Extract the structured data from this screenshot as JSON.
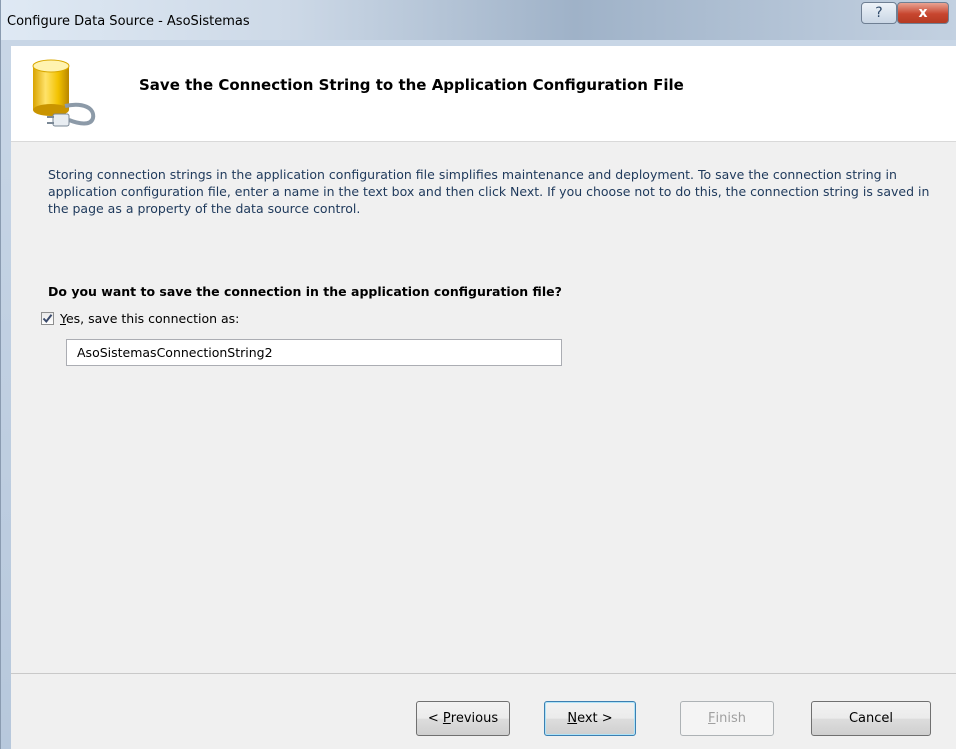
{
  "window": {
    "title": "Configure Data Source - AsoSistemas",
    "help_glyph": "?",
    "close_glyph": "x"
  },
  "header": {
    "title": "Save the Connection String to the Application Configuration File",
    "icon": "database-plug-icon"
  },
  "content": {
    "description": "Storing connection strings in the application configuration file simplifies maintenance and deployment. To save the connection string in application configuration file, enter a name in the text box and then click Next. If you choose not to do this, the connection string is saved in the page as a property of the data source control.",
    "question": "Do you want to save the connection in the application configuration file?",
    "checkbox": {
      "checked": true,
      "accel": "Y",
      "label_rest": "es, save this connection as:"
    },
    "connection_name": "AsoSistemasConnectionString2"
  },
  "buttons": {
    "previous": {
      "prefix": "< ",
      "accel": "P",
      "rest": "revious"
    },
    "next": {
      "accel": "N",
      "rest": "ext >"
    },
    "finish": {
      "accel": "F",
      "rest": "inish",
      "enabled": false
    },
    "cancel": {
      "label": "Cancel"
    }
  },
  "colors": {
    "description_text": "#1e395b",
    "close_button": "#c7462f",
    "default_button_border": "#3c7fb1"
  }
}
